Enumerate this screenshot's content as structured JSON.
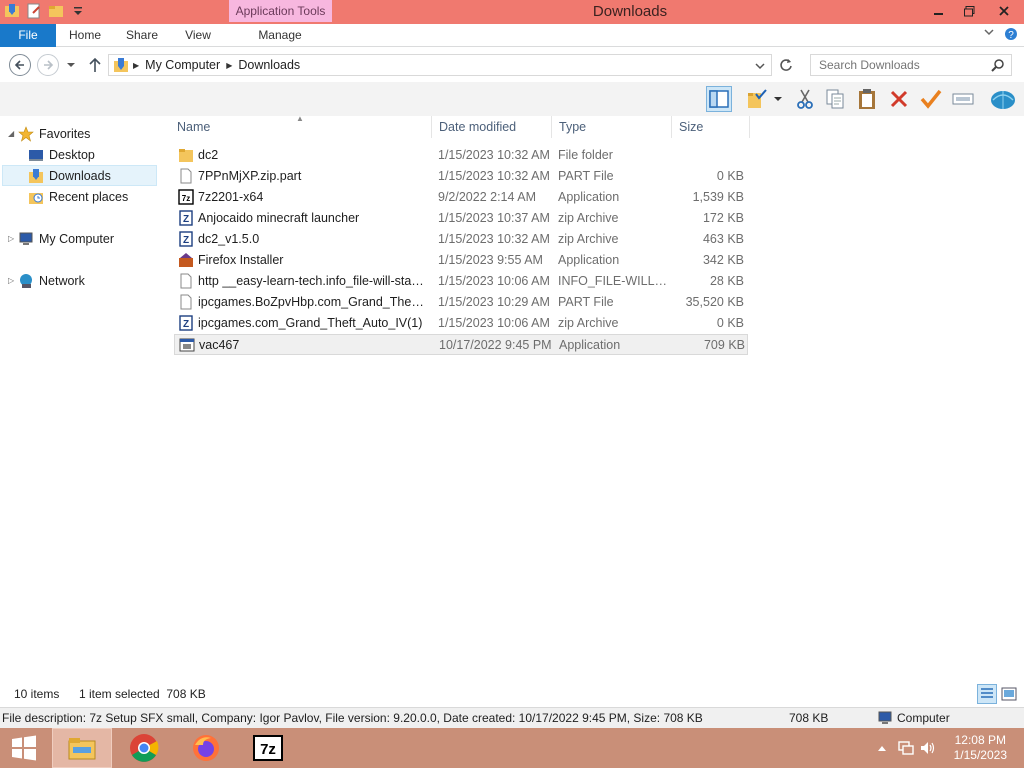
{
  "window": {
    "title": "Downloads",
    "context_tab": "Application Tools"
  },
  "ribbon": {
    "tabs": [
      {
        "label": "File"
      },
      {
        "label": "Home"
      },
      {
        "label": "Share"
      },
      {
        "label": "View"
      },
      {
        "label": "Manage"
      }
    ]
  },
  "address": {
    "crumbs": [
      "My Computer",
      "Downloads"
    ],
    "search_placeholder": "Search Downloads"
  },
  "navpane": {
    "favorites": "Favorites",
    "desktop": "Desktop",
    "downloads": "Downloads",
    "recent": "Recent places",
    "computer": "My Computer",
    "network": "Network"
  },
  "columns": {
    "name": "Name",
    "date": "Date modified",
    "type": "Type",
    "size": "Size"
  },
  "files": [
    {
      "name": "dc2",
      "date": "1/15/2023 10:32 AM",
      "type": "File folder",
      "size": "",
      "icon": "folder-icon"
    },
    {
      "name": "7PPnMjXP.zip.part",
      "date": "1/15/2023 10:32 AM",
      "type": "PART File",
      "size": "0 KB",
      "icon": "file-icon"
    },
    {
      "name": "7z2201-x64",
      "date": "9/2/2022 2:14 AM",
      "type": "Application",
      "size": "1,539 KB",
      "icon": "7zip-icon"
    },
    {
      "name": "Anjocaido minecraft launcher",
      "date": "1/15/2023 10:37 AM",
      "type": "zip Archive",
      "size": "172 KB",
      "icon": "zip-icon"
    },
    {
      "name": "dc2_v1.5.0",
      "date": "1/15/2023 10:32 AM",
      "type": "zip Archive",
      "size": "463 KB",
      "icon": "zip-icon"
    },
    {
      "name": "Firefox Installer",
      "date": "1/15/2023 9:55 AM",
      "type": "Application",
      "size": "342 KB",
      "icon": "installer-icon"
    },
    {
      "name": "http __easy-learn-tech.info_file-will-start...",
      "date": "1/15/2023 10:06 AM",
      "type": "INFO_FILE-WILL-S...",
      "size": "28 KB",
      "icon": "file-icon"
    },
    {
      "name": "ipcgames.BoZpvHbp.com_Grand_Theft_...",
      "date": "1/15/2023 10:29 AM",
      "type": "PART File",
      "size": "35,520 KB",
      "icon": "file-icon"
    },
    {
      "name": "ipcgames.com_Grand_Theft_Auto_IV(1)",
      "date": "1/15/2023 10:06 AM",
      "type": "zip Archive",
      "size": "0 KB",
      "icon": "zip-icon"
    },
    {
      "name": "vac467",
      "date": "10/17/2022 9:45 PM",
      "type": "Application",
      "size": "709 KB",
      "icon": "application-icon",
      "selected": true
    }
  ],
  "status": {
    "items": "10 items",
    "selected": "1 item selected  708 KB"
  },
  "details": {
    "description": "File description: 7z Setup SFX small, Company: Igor Pavlov, File version: 9.20.0.0, Date created: 10/17/2022 9:45 PM, Size: 708 KB",
    "size": "708 KB",
    "location": "Computer"
  },
  "taskbar": {
    "time": "12:08 PM",
    "date": "1/15/2023",
    "apps": [
      "file-explorer",
      "chrome",
      "firefox",
      "7zip"
    ]
  },
  "colors": {
    "titlebar": "#f0796f",
    "file_tab": "#1979ca",
    "taskbar": "#c98f78"
  }
}
